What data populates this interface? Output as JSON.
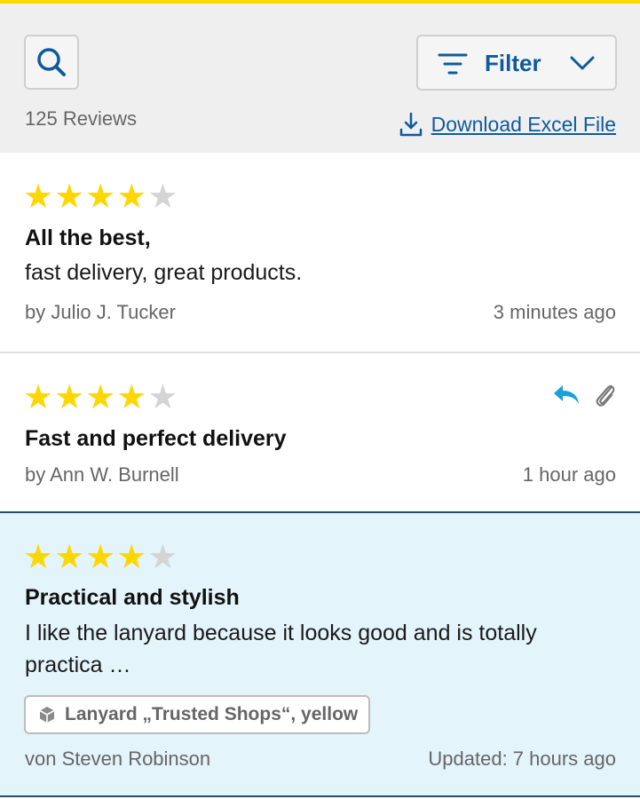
{
  "header": {
    "review_count": "125 Reviews",
    "filter_label": "Filter",
    "download_label": "Download Excel File"
  },
  "reviews": [
    {
      "rating": 4,
      "max_rating": 5,
      "title": "All the best,",
      "body": "fast delivery, great products.",
      "author": "by Julio J. Tucker",
      "time": "3 minutes ago"
    },
    {
      "rating": 4,
      "max_rating": 5,
      "title": "Fast and perfect delivery",
      "author": "by Ann W. Burnell",
      "time": "1 hour ago",
      "icons": [
        "reply-icon",
        "attachment-icon"
      ]
    },
    {
      "rating": 4,
      "max_rating": 5,
      "title": "Practical and stylish",
      "body": "I like the lanyard because it looks good and is totally practica …",
      "product": "Lanyard „Trusted Shops“, yellow",
      "author": "von Steven Robinson",
      "time": "Updated: 7 hours ago"
    }
  ],
  "colors": {
    "accent_yellow": "#ffd800",
    "link_blue": "#0f5a9c",
    "reply_cyan": "#1aa0d8",
    "star_filled": "#ffd700",
    "star_empty": "#d4d4d4",
    "highlight_bg": "#e3f4fa"
  }
}
